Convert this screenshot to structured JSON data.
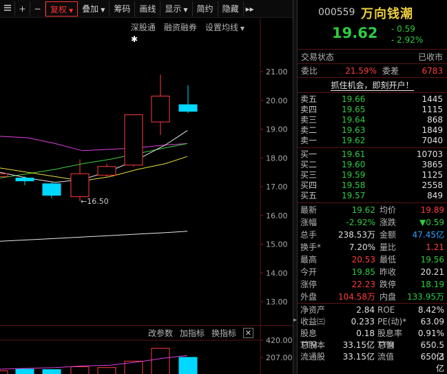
{
  "toolbar": {
    "items": [
      {
        "label": "",
        "icon": "menu-icon"
      },
      {
        "label": "+",
        "icon": "zoom-in-icon"
      },
      {
        "label": "−",
        "icon": "zoom-out-icon"
      },
      {
        "label": "复权",
        "dropdown": true,
        "active": true
      },
      {
        "label": "叠加",
        "dropdown": true
      },
      {
        "label": "筹码"
      },
      {
        "label": "画线"
      },
      {
        "label": "显示",
        "dropdown": true
      },
      {
        "label": "简约"
      },
      {
        "label": "隐藏"
      }
    ],
    "more_label": "▸▸"
  },
  "chart_links": {
    "shenzhen": "深股通",
    "margin": "融资融券",
    "ma_settings": "设置均线"
  },
  "chart_data": {
    "type": "candlestick",
    "y_axis_ticks": [
      "21.00",
      "20.00",
      "19.00",
      "18.00",
      "17.00",
      "16.00",
      "15.00",
      "14.00",
      "13.00"
    ],
    "ylim": [
      12.5,
      22.0
    ],
    "low_annotation": "16.50",
    "candles": [
      {
        "open": 17.45,
        "close": 17.35,
        "high": 17.5,
        "low": 17.25,
        "color": "red"
      },
      {
        "open": 17.3,
        "close": 17.2,
        "high": 17.35,
        "low": 17.05,
        "color": "cyan"
      },
      {
        "open": 17.1,
        "close": 16.7,
        "high": 17.15,
        "low": 16.6,
        "color": "cyan"
      },
      {
        "open": 16.65,
        "close": 17.45,
        "high": 17.95,
        "low": 16.5,
        "color": "red"
      },
      {
        "open": 17.4,
        "close": 17.7,
        "high": 17.8,
        "low": 17.35,
        "color": "red"
      },
      {
        "open": 17.75,
        "close": 19.5,
        "high": 19.5,
        "low": 17.7,
        "color": "red"
      },
      {
        "open": 19.25,
        "close": 20.15,
        "high": 20.9,
        "low": 18.8,
        "color": "red"
      },
      {
        "open": 19.85,
        "close": 19.62,
        "high": 20.53,
        "low": 19.56,
        "color": "cyan"
      }
    ],
    "volume": {
      "y_axis_ticks": [
        "420.00",
        "207.00"
      ],
      "bars": [
        40,
        60,
        55,
        90,
        80,
        160,
        320,
        207
      ]
    }
  },
  "indicator_bar": {
    "params": "改参数",
    "add": "加指标",
    "change": "换指标",
    "close": "✕"
  },
  "quote": {
    "code": "000559",
    "name": "万向钱潮",
    "price": "19.62",
    "change": "- 0.59",
    "change_pct": "- 2.92%",
    "status_label": "交易状态",
    "status_value": "已收市",
    "ratio_label": "委比",
    "ratio_value": "21.59%",
    "diff_label": "委差",
    "diff_value": "6783",
    "open_account": "抓住机会，即刻开户！",
    "asks": [
      {
        "label": "卖五",
        "price": "19.66",
        "vol": "1445"
      },
      {
        "label": "卖四",
        "price": "19.65",
        "vol": "1115"
      },
      {
        "label": "卖三",
        "price": "19.64",
        "vol": "868"
      },
      {
        "label": "卖二",
        "price": "19.63",
        "vol": "1849"
      },
      {
        "label": "卖一",
        "price": "19.62",
        "vol": "7040"
      }
    ],
    "bids": [
      {
        "label": "买一",
        "price": "19.61",
        "vol": "10703"
      },
      {
        "label": "买二",
        "price": "19.60",
        "vol": "3865"
      },
      {
        "label": "买三",
        "price": "19.59",
        "vol": "1125"
      },
      {
        "label": "买四",
        "price": "19.58",
        "vol": "2558"
      },
      {
        "label": "买五",
        "price": "19.57",
        "vol": "849"
      }
    ],
    "stats": [
      {
        "l1": "最新",
        "v1": "19.62",
        "c1": "green",
        "l2": "均价",
        "v2": "19.89",
        "c2": "red"
      },
      {
        "l1": "涨幅",
        "v1": "-2.92%",
        "c1": "green",
        "l2": "涨跌",
        "v2": "▼0.59",
        "c2": "green"
      },
      {
        "l1": "总手",
        "v1": "238.53万",
        "c1": "white",
        "l2": "金额",
        "v2": "47.45亿",
        "c2": "blue"
      },
      {
        "l1": "换手*",
        "v1": "7.20%",
        "c1": "white",
        "l2": "量比",
        "v2": "1.21",
        "c2": "red"
      },
      {
        "l1": "最高",
        "v1": "20.53",
        "c1": "red",
        "l2": "最低",
        "v2": "19.56",
        "c2": "green"
      },
      {
        "l1": "今开",
        "v1": "19.85",
        "c1": "green",
        "l2": "昨收",
        "v2": "20.21",
        "c2": "white"
      },
      {
        "l1": "涨停",
        "v1": "22.23",
        "c1": "red",
        "l2": "跌停",
        "v2": "18.19",
        "c2": "green"
      },
      {
        "l1": "外盘",
        "v1": "104.58万",
        "c1": "red",
        "l2": "内盘",
        "v2": "133.95万",
        "c2": "green"
      }
    ],
    "indicators": [
      {
        "l1": "净资产",
        "v1": "2.84",
        "l2": "ROE",
        "v2": "8.42%"
      },
      {
        "l1": "收益㈢",
        "v1": "0.233",
        "l2": "PE(动)*",
        "v2": "63.09"
      },
      {
        "l1": "股息TTM",
        "v1": "0.18",
        "l2": "股息率TTM",
        "v2": "0.91%"
      },
      {
        "l1": "总股本",
        "v1": "33.15亿",
        "l2": "总值",
        "v2": "650.5亿"
      },
      {
        "l1": "流通股",
        "v1": "33.15亿",
        "l2": "流值",
        "v2": "650.3亿"
      }
    ]
  },
  "colors": {
    "up": "#ff3c3c",
    "down": "#2ecc40",
    "down_candle": "#00d8ff",
    "grid_red": "#5a1414",
    "name_yellow": "#f0d040"
  }
}
